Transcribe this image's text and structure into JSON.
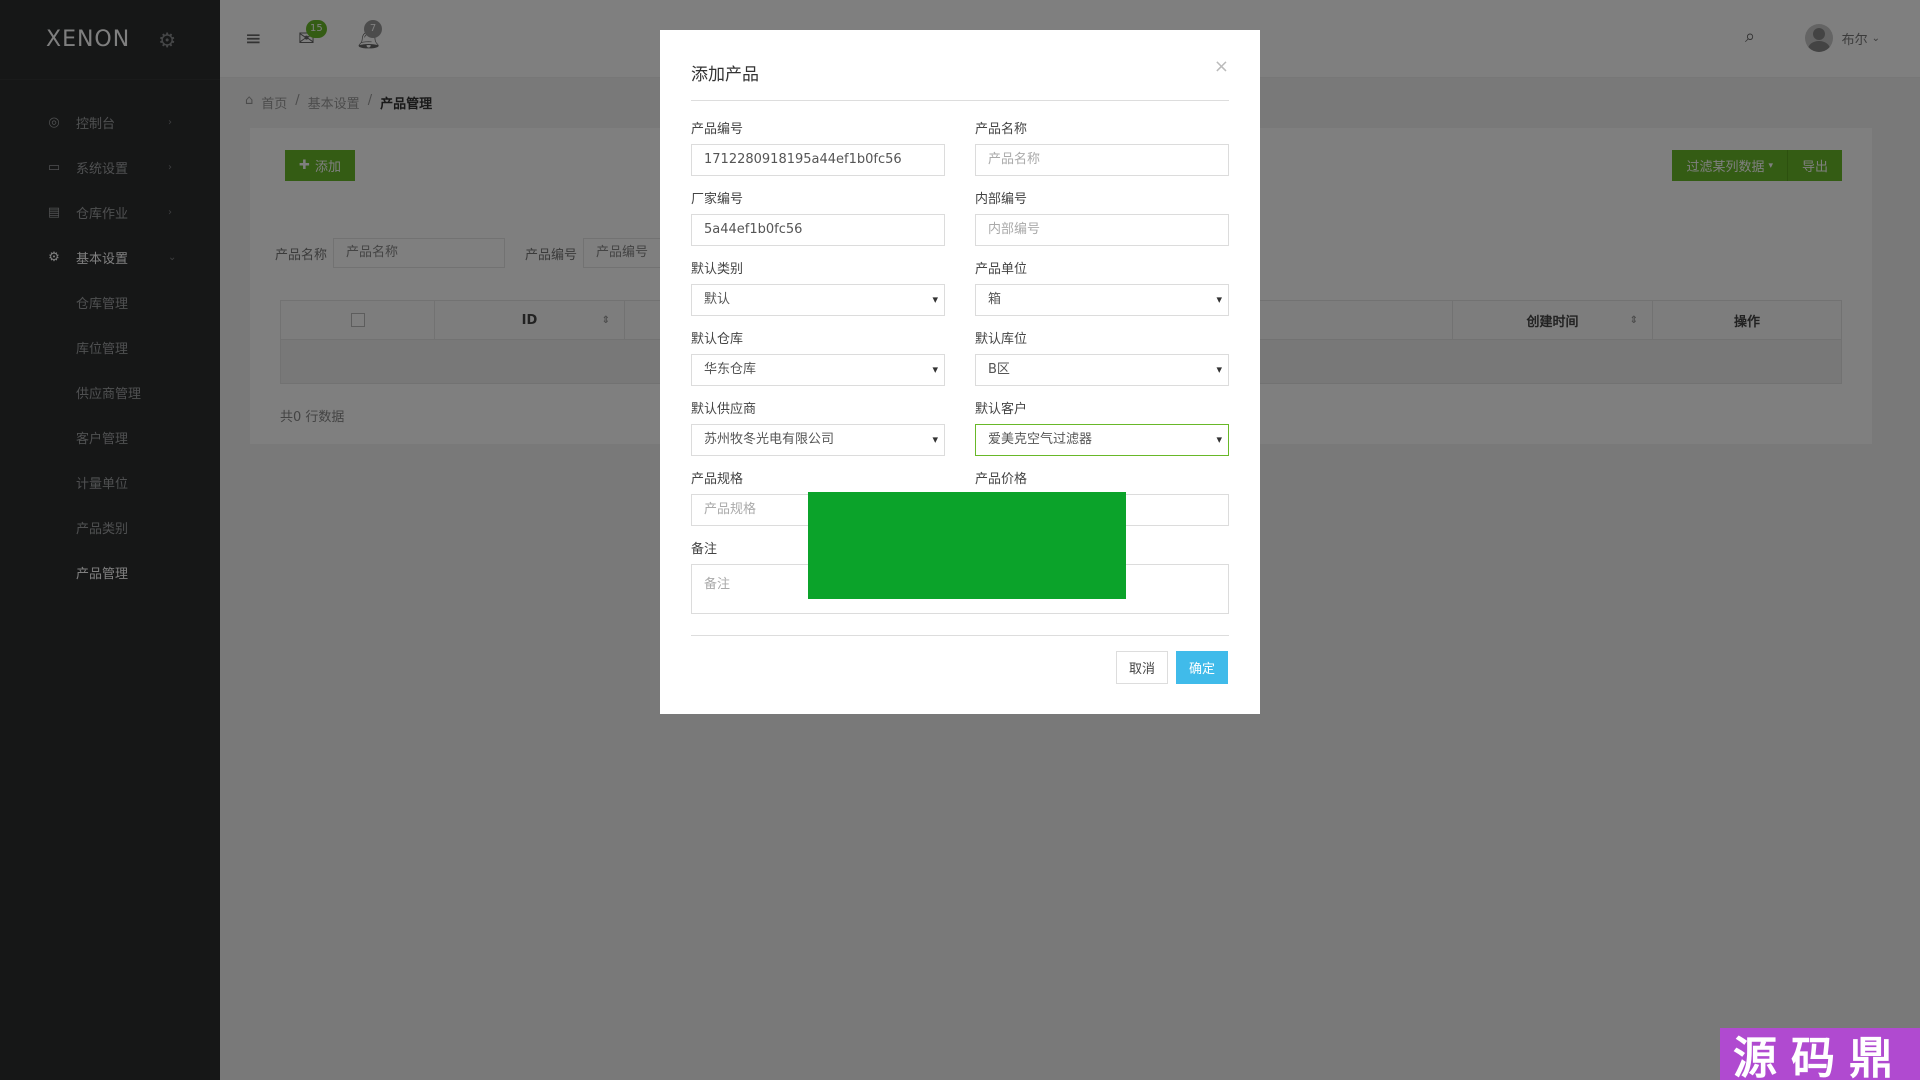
{
  "app": {
    "logo": "XENON"
  },
  "sidebar": {
    "items": [
      {
        "label": "控制台",
        "icon": "dashboard-icon"
      },
      {
        "label": "系统设置",
        "icon": "monitor-icon"
      },
      {
        "label": "仓库作业",
        "icon": "archive-icon"
      },
      {
        "label": "基本设置",
        "icon": "gear-icon"
      }
    ],
    "submenu": [
      "仓库管理",
      "库位管理",
      "供应商管理",
      "客户管理",
      "计量单位",
      "产品类别",
      "产品管理"
    ]
  },
  "header": {
    "mail_badge": "15",
    "bell_badge": "7",
    "user_name": "布尔"
  },
  "breadcrumb": {
    "home": "首页",
    "level1": "基本设置",
    "current": "产品管理"
  },
  "panel": {
    "add_button": "添加",
    "filter_columns_button": "过滤某列数据",
    "export_button": "导出",
    "filter": {
      "product_name_label": "产品名称",
      "product_name_placeholder": "产品名称",
      "product_code_label": "产品编号",
      "product_code_placeholder": "产品编号"
    },
    "table": {
      "columns": [
        "ID",
        "创建时间",
        "操作"
      ]
    },
    "total_text": "共0 行数据"
  },
  "modal": {
    "title": "添加产品",
    "close": "×",
    "fields": {
      "product_code": {
        "label": "产品编号",
        "value": "1712280918195a44ef1b0fc56"
      },
      "product_name": {
        "label": "产品名称",
        "placeholder": "产品名称"
      },
      "factory_code": {
        "label": "厂家编号",
        "value": "5a44ef1b0fc56"
      },
      "internal_code": {
        "label": "内部编号",
        "placeholder": "内部编号"
      },
      "default_category": {
        "label": "默认类别",
        "value": "默认"
      },
      "product_unit": {
        "label": "产品单位",
        "value": "箱"
      },
      "default_warehouse": {
        "label": "默认仓库",
        "value": "华东仓库"
      },
      "default_location": {
        "label": "默认库位",
        "value": "B区"
      },
      "default_supplier": {
        "label": "默认供应商",
        "value": "苏州牧冬光电有限公司"
      },
      "default_customer": {
        "label": "默认客户",
        "value": "爱美克空气过滤器"
      },
      "product_spec": {
        "label": "产品规格",
        "placeholder": "产品规格"
      },
      "product_price": {
        "label": "产品价格"
      },
      "remark": {
        "label": "备注",
        "placeholder": "备注"
      }
    },
    "cancel_button": "取消",
    "ok_button": "确定"
  },
  "watermark": "源码鼎",
  "colors": {
    "accent_green": "#68b828",
    "primary_blue": "#40bbea",
    "sidebar_bg": "#2c2e2f",
    "redaction_green": "#0ba32a"
  }
}
